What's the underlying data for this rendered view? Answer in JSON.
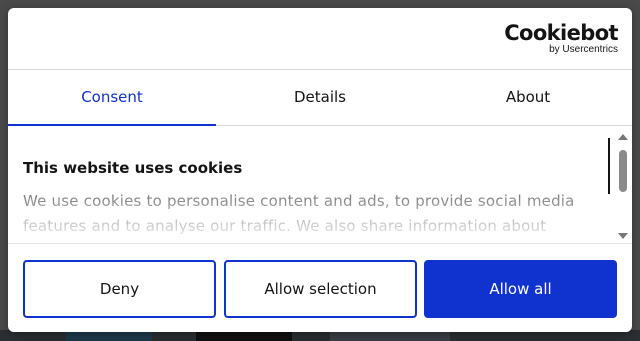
{
  "brand": {
    "logo_main": "Cookiebot",
    "logo_sub": "by Usercentrics"
  },
  "tabs": [
    {
      "label": "Consent",
      "active": true
    },
    {
      "label": "Details",
      "active": false
    },
    {
      "label": "About",
      "active": false
    }
  ],
  "content": {
    "title": "This website uses cookies",
    "body": "We use cookies to personalise content and ads, to provide social media features and to analyse our traffic. We also share information about your"
  },
  "buttons": {
    "deny": "Deny",
    "allow_selection": "Allow selection",
    "allow_all": "Allow all"
  },
  "colors": {
    "accent": "#1032cf",
    "text": "#141414",
    "backdrop": "#4a4a4a"
  },
  "icons": {
    "scroll_up": "triangle-up",
    "scroll_down": "triangle-down"
  }
}
